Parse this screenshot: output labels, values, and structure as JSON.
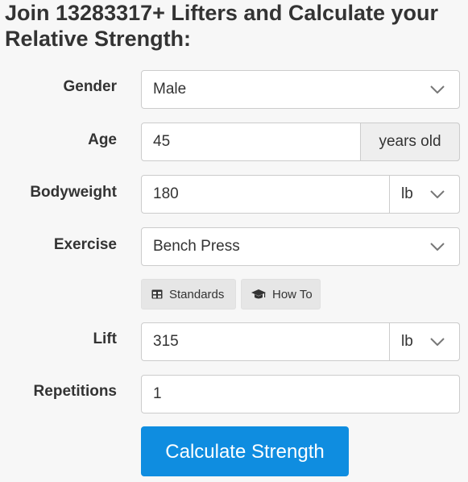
{
  "title": "Join 13283317+ Lifters and Calculate your Relative Strength:",
  "fields": {
    "gender": {
      "label": "Gender",
      "value": "Male"
    },
    "age": {
      "label": "Age",
      "value": "45",
      "addon": "years old"
    },
    "bodyweight": {
      "label": "Bodyweight",
      "value": "180",
      "unit": "lb"
    },
    "exercise": {
      "label": "Exercise",
      "value": "Bench Press"
    },
    "lift": {
      "label": "Lift",
      "value": "315",
      "unit": "lb"
    },
    "repetitions": {
      "label": "Repetitions",
      "value": "1"
    }
  },
  "buttons": {
    "standards": "Standards",
    "how_to": "How To",
    "calculate": "Calculate Strength"
  },
  "icons": {
    "dropdown": "chevron-down-icon",
    "standards": "table-icon",
    "how_to": "graduation-cap-icon"
  },
  "colors": {
    "primary": "#0f8de0",
    "background": "#f7f7f7",
    "secondary_button": "#e6e6e6"
  }
}
